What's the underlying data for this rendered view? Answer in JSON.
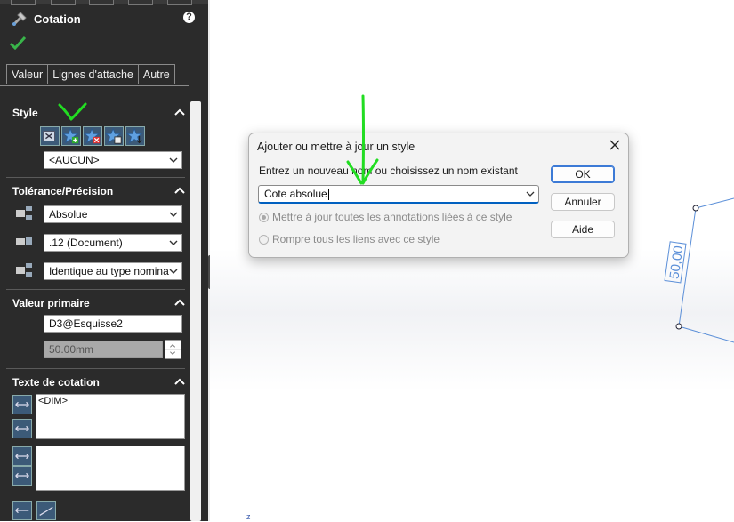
{
  "panel": {
    "title": "Cotation",
    "help_glyph": "?",
    "tabs": [
      "Valeur",
      "Lignes d'attache",
      "Autre"
    ],
    "style": {
      "title": "Style",
      "selected": "<AUCUN>"
    },
    "tolerance": {
      "title": "Tolérance/Précision",
      "type": "Absolue",
      "precision": ".12 (Document)",
      "tolerance_precision": "Identique au type nominal"
    },
    "primary_value": {
      "title": "Valeur primaire",
      "name": "D3@Esquisse2",
      "value": "50.00mm"
    },
    "dimension_text": {
      "title": "Texte de cotation",
      "content": "<DIM>"
    }
  },
  "dialog": {
    "title": "Ajouter ou mettre à jour un style",
    "prompt": "Entrez un nouveau nom ou choisissez un nom existant",
    "input_value": "Cote absolue",
    "radio_update": "Mettre à jour toutes les annotations liées à ce style",
    "radio_break": "Rompre tous les liens avec ce style",
    "ok": "OK",
    "cancel": "Annuler",
    "help": "Aide"
  },
  "canvas": {
    "dimension_label": "50,00",
    "axis_glyph": "z"
  },
  "colors": {
    "panel_bg": "#2b2b2b",
    "accent_blue": "#0060c0",
    "annotation_green": "#22dd22",
    "sketch_blue": "#3c7ad6"
  }
}
